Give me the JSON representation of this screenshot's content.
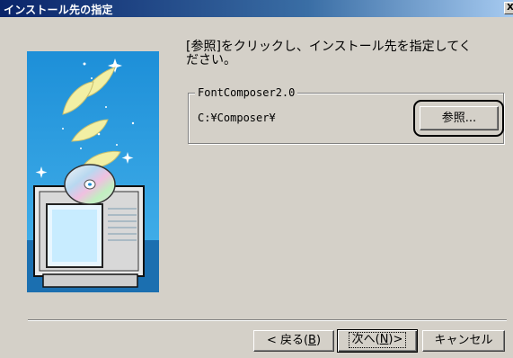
{
  "window": {
    "title": "インストール先の指定",
    "close_glyph": "X"
  },
  "content": {
    "instruction_line1": "[参照]をクリックし、インストール先を指定してく",
    "instruction_line2": "ださい。",
    "group_label": "FontComposer2.0",
    "install_path": "C:¥Composer¥",
    "browse_label": "参照..."
  },
  "buttons": {
    "back_prefix": "< 戻る(",
    "back_key": "B",
    "back_suffix": ")",
    "next_prefix": "次へ(",
    "next_key": "N",
    "next_suffix": ")>",
    "cancel_label": "キャンセル"
  },
  "colors": {
    "dialog_bg": "#d4d0c8",
    "title_gradient_start": "#0a246a",
    "title_gradient_end": "#a6caf0",
    "image_sky": "#2a9ee0"
  },
  "icons": {
    "close": "close-icon",
    "illustration": "computer-cd-feathers-illustration"
  }
}
